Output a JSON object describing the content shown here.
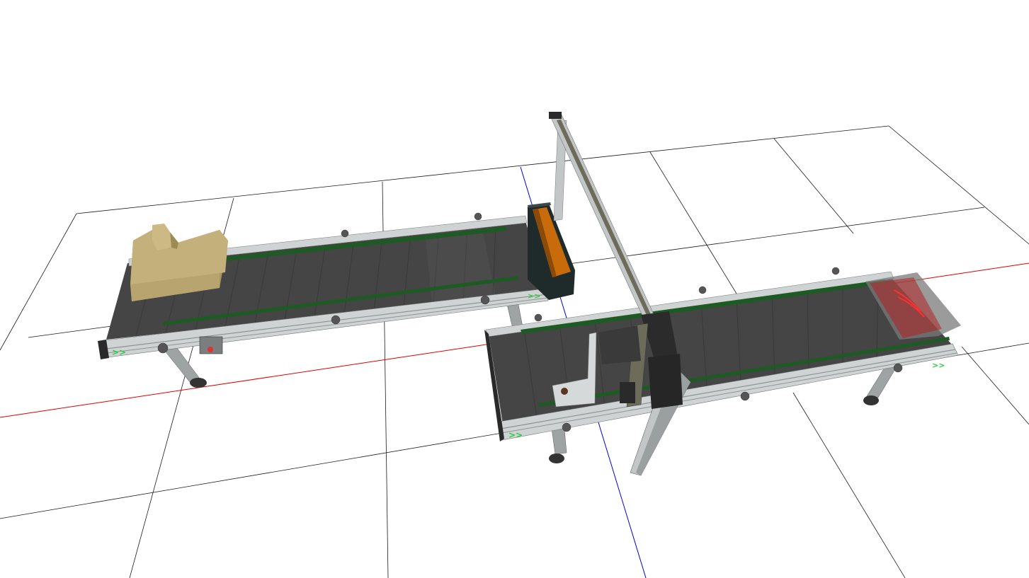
{
  "scene": {
    "background_color": "#ffffff",
    "grid_color": "#1a1a1a",
    "x_axis_color": "#e00000",
    "y_axis_color": "#0000e0",
    "belt_color": "#454545",
    "belt_stripe_color": "#3a3a3a",
    "rail_color": "#cfd3d3",
    "rail_dark_color": "#8e9494",
    "guide_color": "#1e5a24",
    "arrow_color": "#2ecc40",
    "box_color": "#c4b07a",
    "box_dark_color": "#a8955f",
    "bin_color": "#1f2a2a",
    "bin_inner_color": "#c86b0a",
    "gantry_color": "#c2c6c6",
    "gantry_dark_color": "#6d6b5a",
    "sensor_color": "#d02020",
    "objects": {
      "conveyor_left": "conveyor-belt",
      "conveyor_right": "conveyor-belt",
      "box": "cardboard-box",
      "bin": "collection-bin",
      "gantry": "gantry-robot",
      "sensor": "laser-sensor"
    }
  }
}
